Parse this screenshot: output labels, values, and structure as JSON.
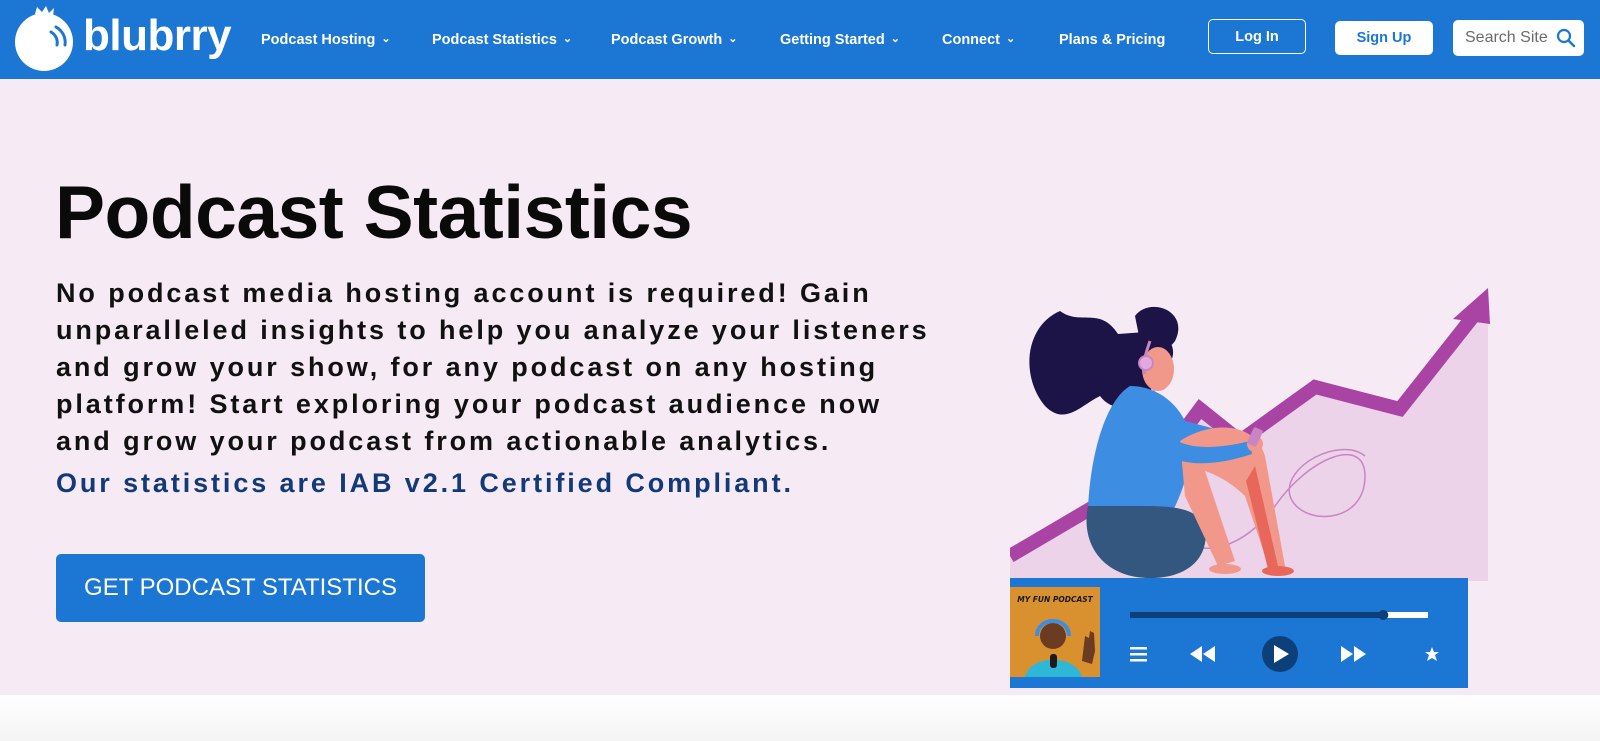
{
  "brand": {
    "name": "blubrry"
  },
  "nav": {
    "items": [
      {
        "label": "Podcast Hosting",
        "has_dropdown": true
      },
      {
        "label": "Podcast Statistics",
        "has_dropdown": true
      },
      {
        "label": "Podcast Growth",
        "has_dropdown": true
      },
      {
        "label": "Getting Started",
        "has_dropdown": true
      },
      {
        "label": "Connect",
        "has_dropdown": true
      },
      {
        "label": "Plans & Pricing",
        "has_dropdown": false
      }
    ],
    "login_label": "Log In",
    "signup_label": "Sign Up",
    "search_placeholder": "Search Site"
  },
  "hero": {
    "title": "Podcast Statistics",
    "description": "No podcast media hosting account is required! Gain unparalleled insights to help you analyze your listeners and grow your show, for any podcast on any hosting platform! Start exploring your podcast audience now and grow your podcast from actionable analytics.",
    "certification": "Our statistics are IAB v2.1 Certified Compliant.",
    "cta_label": "GET PODCAST STATISTICS"
  },
  "illustration": {
    "player_podcast_title": "MY FUN PODCAST",
    "player_progress": 0.85
  },
  "colors": {
    "nav_blue": "#1b76d4",
    "hero_background": "#f6eaf5",
    "certification_text": "#123a78",
    "chart_arrow": "#a944a5"
  }
}
